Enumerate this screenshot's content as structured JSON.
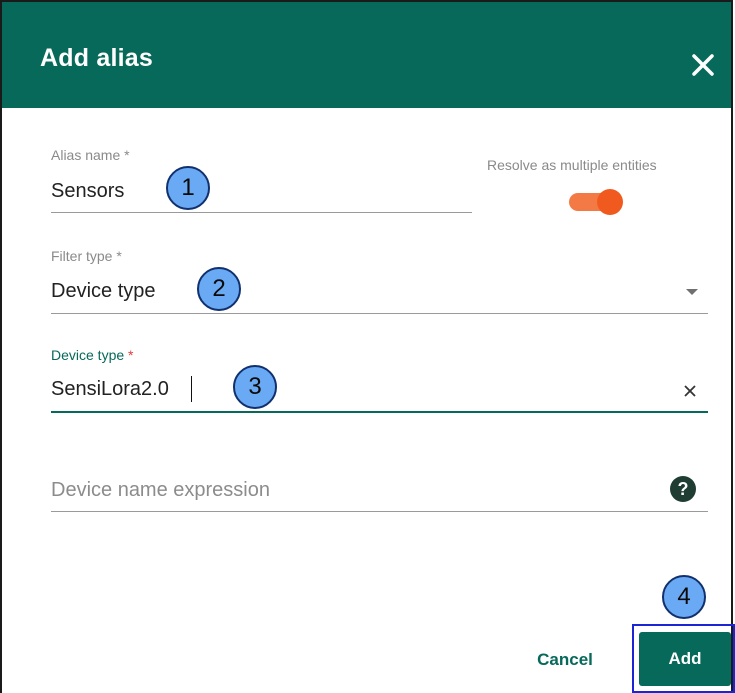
{
  "dialog": {
    "title": "Add alias",
    "close_icon": "close-icon"
  },
  "alias_name": {
    "label": "Alias name *",
    "value": "Sensors"
  },
  "resolve_multiple": {
    "label": "Resolve as multiple entities",
    "enabled": true,
    "toggle_color": "#f15a1e"
  },
  "filter_type": {
    "label": "Filter type *",
    "value": "Device type"
  },
  "device_type": {
    "label": "Device type",
    "required_mark": "*",
    "value": "SensiLora2.0"
  },
  "device_name_expression": {
    "placeholder": "Device name expression",
    "help_icon": "help-icon"
  },
  "buttons": {
    "cancel": "Cancel",
    "add": "Add"
  },
  "step_markers": [
    "1",
    "2",
    "3",
    "4"
  ],
  "colors": {
    "primary": "#06695a",
    "marker": "#6aaaf5",
    "highlight": "#1b25d6"
  }
}
